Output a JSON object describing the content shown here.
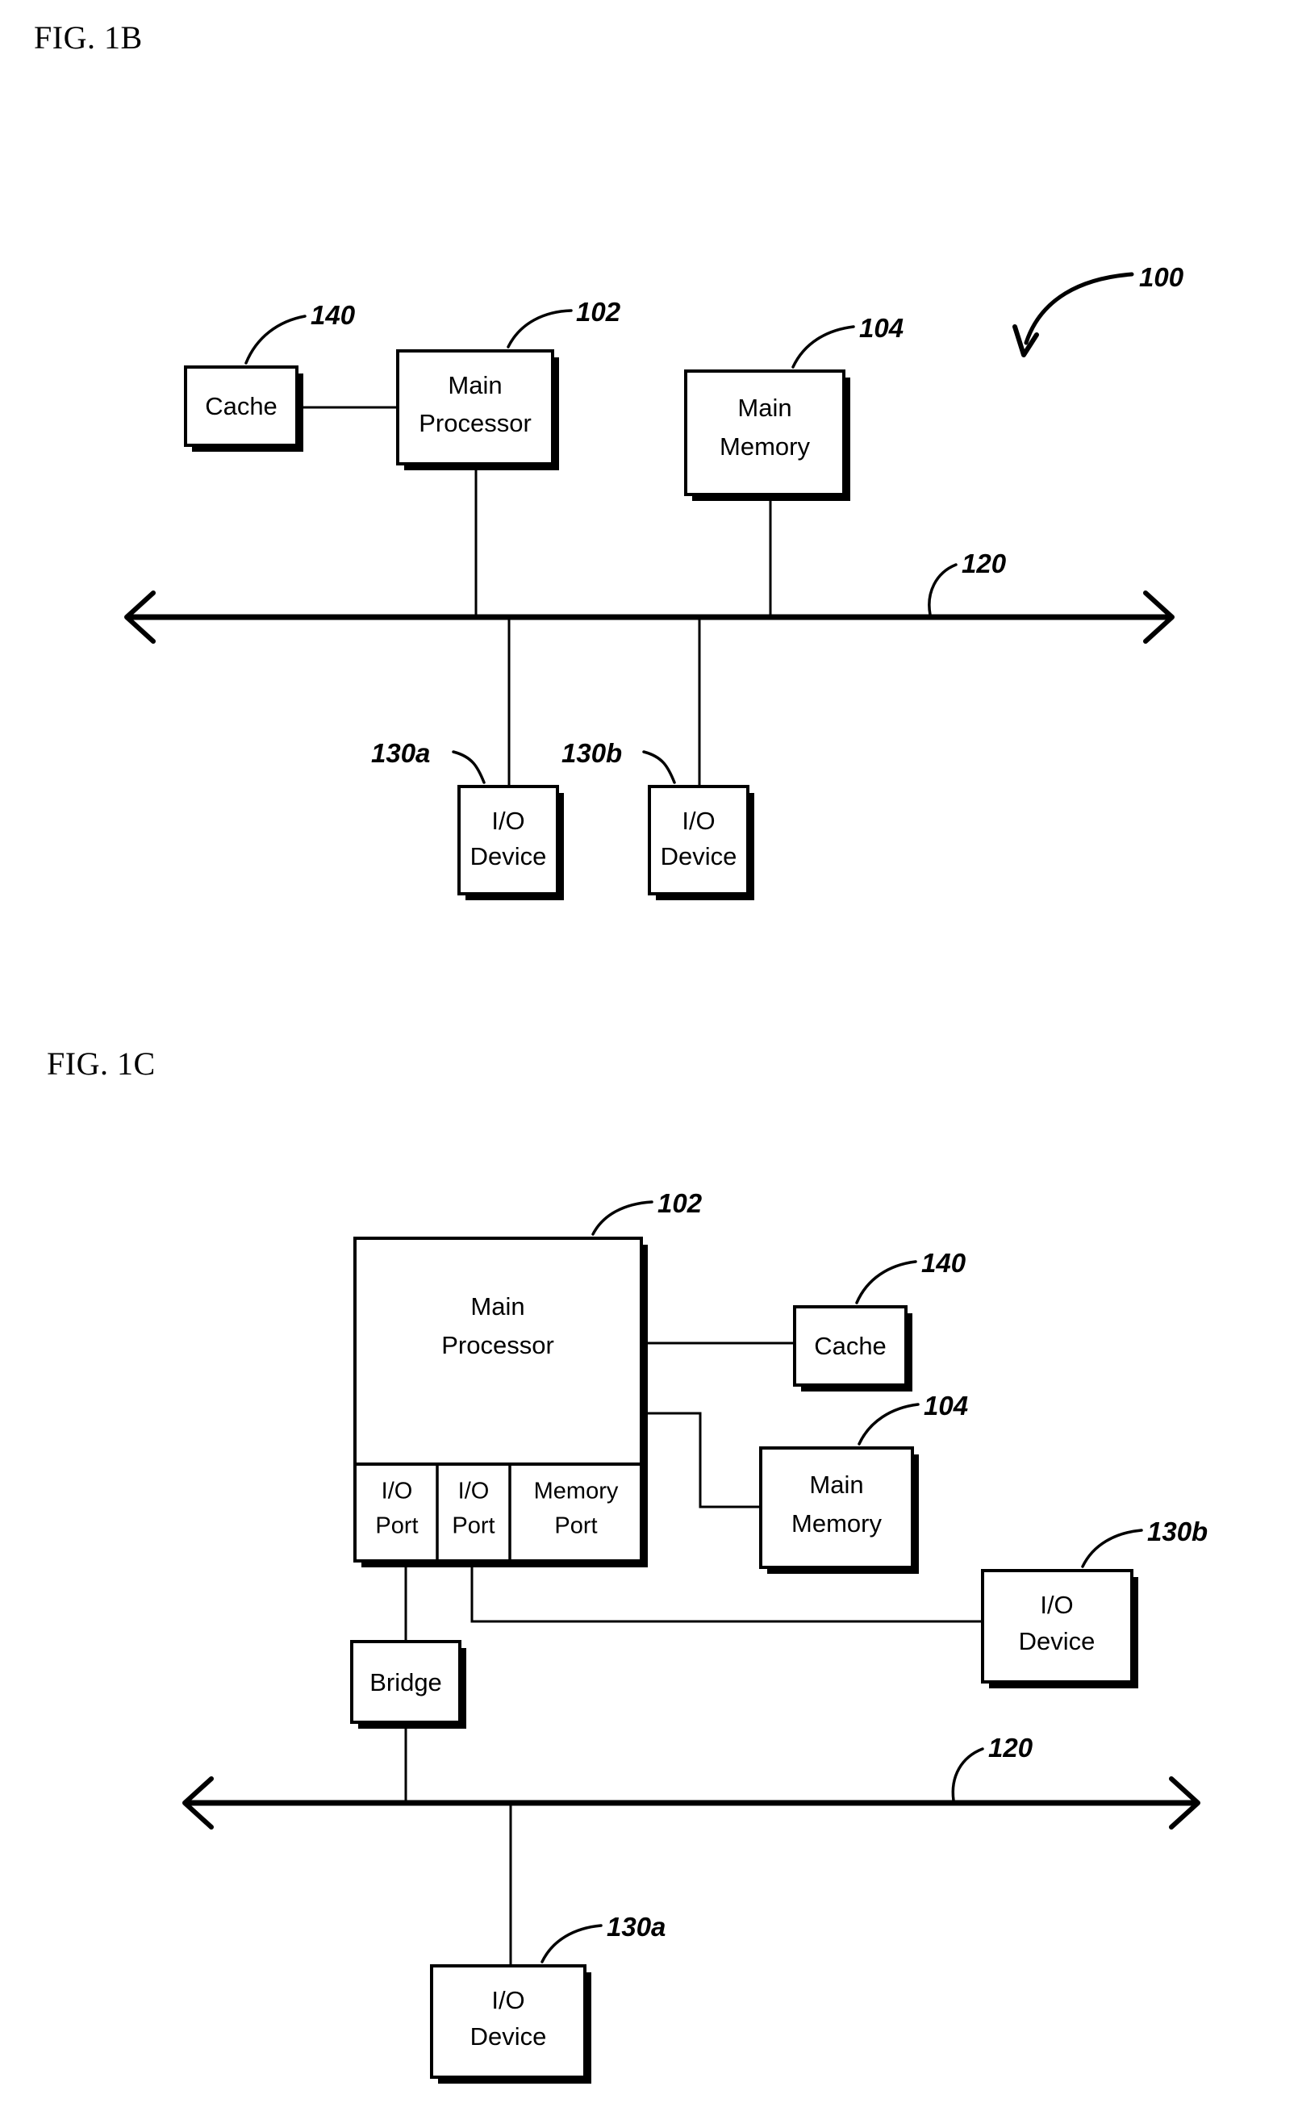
{
  "figures": [
    {
      "title": "FIG. 1B",
      "ref_overall": "100",
      "blocks": {
        "cache": "Cache",
        "main_processor_line1": "Main",
        "main_processor_line2": "Processor",
        "main_memory_line1": "Main",
        "main_memory_line2": "Memory",
        "io_device_a_line1": "I/O",
        "io_device_a_line2": "Device",
        "io_device_b_line1": "I/O",
        "io_device_b_line2": "Device"
      },
      "refs": {
        "cache": "140",
        "main_processor": "102",
        "main_memory": "104",
        "bus": "120",
        "io_device_a": "130a",
        "io_device_b": "130b"
      }
    },
    {
      "title": "FIG. 1C",
      "blocks": {
        "main_processor_line1": "Main",
        "main_processor_line2": "Processor",
        "io_port_1_line1": "I/O",
        "io_port_1_line2": "Port",
        "io_port_2_line1": "I/O",
        "io_port_2_line2": "Port",
        "memory_port_line1": "Memory",
        "memory_port_line2": "Port",
        "cache": "Cache",
        "main_memory_line1": "Main",
        "main_memory_line2": "Memory",
        "io_device_b_line1": "I/O",
        "io_device_b_line2": "Device",
        "bridge": "Bridge",
        "io_device_a_line1": "I/O",
        "io_device_a_line2": "Device"
      },
      "refs": {
        "main_processor": "102",
        "cache": "140",
        "main_memory": "104",
        "io_device_b": "130b",
        "bus": "120",
        "io_device_a": "130a"
      }
    }
  ],
  "colors": {
    "ink": "#000000",
    "paper": "#ffffff"
  }
}
